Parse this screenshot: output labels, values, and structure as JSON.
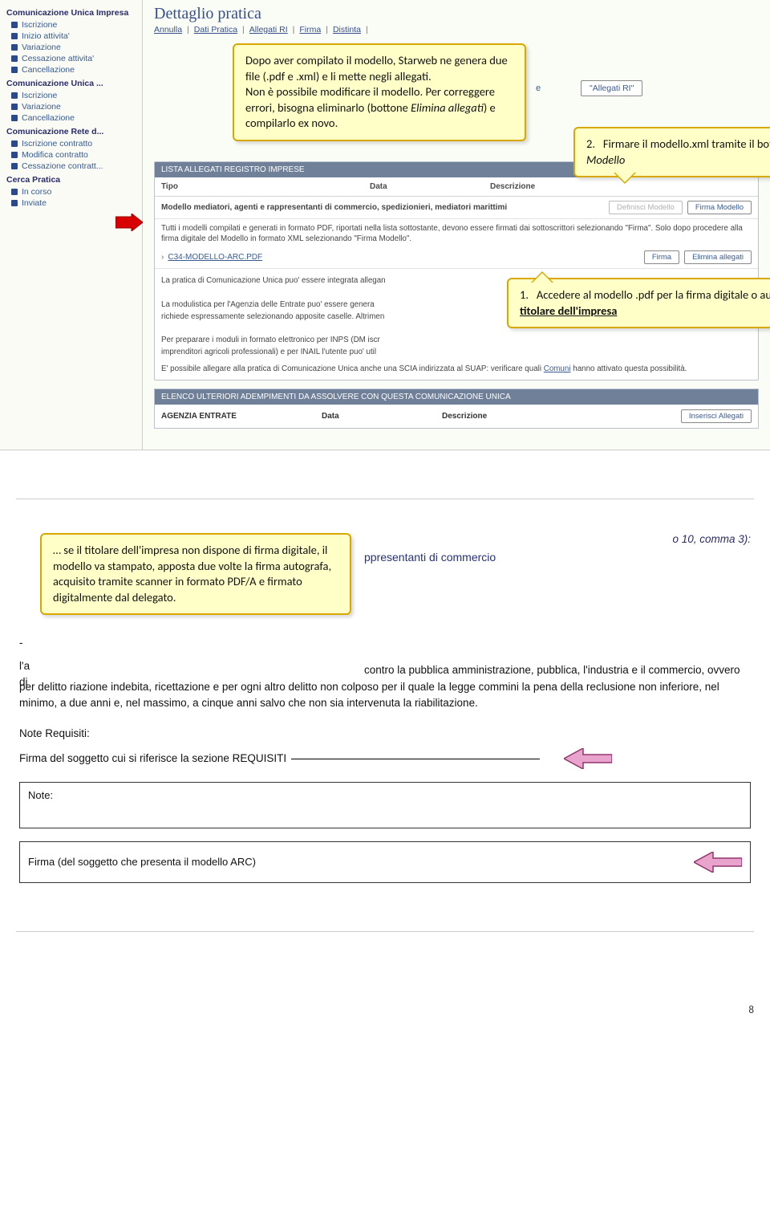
{
  "sidebar": {
    "groups": [
      {
        "title": "Comunicazione Unica Impresa",
        "items": [
          "Iscrizione",
          "Inizio attivita'",
          "Variazione",
          "Cessazione attivita'",
          "Cancellazione"
        ]
      },
      {
        "title": "Comunicazione Unica ...",
        "items": [
          "Iscrizione",
          "Variazione",
          "Cancellazione"
        ]
      },
      {
        "title": "Comunicazione Rete d...",
        "items": [
          "Iscrizione contratto",
          "Modifica contratto",
          "Cessazione contratt..."
        ]
      },
      {
        "title": "Cerca Pratica",
        "items": [
          "In corso",
          "Inviate"
        ]
      }
    ]
  },
  "page": {
    "title": "Dettaglio pratica",
    "nav": [
      "Annulla",
      "Dati Pratica",
      "Allegati RI",
      "Firma",
      "Distinta"
    ],
    "allegati_label": "e",
    "allegati_btn": "\"Allegati RI\"",
    "list_header": "LISTA ALLEGATI REGISTRO IMPRESE",
    "cols": {
      "tipo": "Tipo",
      "data": "Data",
      "desc": "Descrizione"
    },
    "model_row": "Modello mediatori, agenti e rappresentanti di commercio, spedizionieri, mediatori marittimi",
    "btn_def": "Definisci Modello",
    "btn_firma_mod": "Firma Modello",
    "note1": "Tutti i modelli compilati e generati in formato PDF, riportati nella lista sottostante, devono essere firmati dai sottoscrittori selezionando \"Firma\". Solo dopo procedere alla firma digitale del Modello in formato XML selezionando \"Firma Modello\".",
    "file": "C34-MODELLO-ARC.PDF",
    "btn_firma": "Firma",
    "btn_elimina": "Elimina allegati",
    "info": "La pratica di Comunicazione Unica puo' essere integrata allegan\n\nLa modulistica per l'Agenzia delle Entrate puo' essere genera\nrichiede espressamente selezionando apposite caselle. Altrimen\n\nPer preparare i moduli in formato elettronico per INPS (DM iscr\nimprenditori agricoli professionali) e per INAIL l'utente puo' util",
    "suap_line": "E' possibile allegare alla pratica di Comunicazione Unica anche una SCIA indirizzata al SUAP: verificare quali",
    "suap_link": "Comuni",
    "suap_after": "hanno attivato questa possibilità.",
    "elenco": "ELENCO ULTERIORI ADEMPIMENTI DA ASSOLVERE CON QUESTA COMUNICAZIONE UNICA",
    "agenzia": "AGENZIA ENTRATE",
    "data_lbl": "Data",
    "desc_lbl": "Descrizione",
    "btn_ins": "Inserisci Allegati"
  },
  "callouts": {
    "c1": "Dopo aver compilato il modello, Starweb ne genera due file (.pdf e .xml) e li mette negli allegati.\nNon è possibile modificare il modello. Per correggere errori, bisogna eliminarlo (bottone Elimina allegati) e compilarlo ex novo.",
    "c1_html_parts": {
      "pre": "Dopo aver compilato il modello, Starweb ne genera due file (.pdf e .xml) e li mette negli allegati.",
      "post1": "Non è possibile modificare il modello. Per correggere errori, bisogna eliminarlo (bottone ",
      "em": "Elimina allegati",
      "post2": ") e compilarlo ex novo."
    },
    "c2_num": "2.",
    "c2_pre": "Firmare il modello.xml tramite il bottone ",
    "c2_em": "Firma Modello",
    "c3_num": "1.",
    "c3_pre": "Accedere al modello .pdf per la firma digitale o autografa ",
    "c3_u": "del titolare dell'impresa",
    "c4": "… se il titolare dell'impresa non dispone di firma digitale, il modello va stampato, apposta due volte la firma autografa, acquisito tramite scanner in formato PDF/A e firmato digitalmente dal delegato."
  },
  "doc": {
    "head_right": "o 10, comma 3):",
    "blue_line": "ppresentanti di commercio",
    "body": "contro la pubblica amministrazione, pubblica, l'industria e il commercio, ovvero per delitto riazione indebita, ricettazione e per ogni altro delitto non colposo per il quale la legge commini la pena della reclusione non inferiore, nel minimo, a due anni e, nel massimo, a cinque anni salvo che non sia intervenuta la riabilitazione.",
    "body_pre_lines": [
      "l'a",
      "di"
    ],
    "note_label": "Note Requisiti:",
    "sig_label": "Firma del soggetto cui si riferisce la sezione REQUISITI",
    "box_note": "Note:",
    "box_firma": "Firma (del soggetto che presenta il modello ARC)"
  },
  "page_number": "8"
}
